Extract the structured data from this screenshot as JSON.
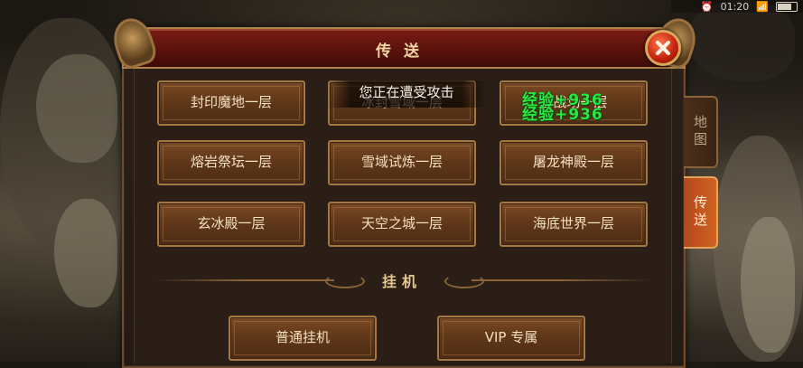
{
  "status": {
    "time": "01:20"
  },
  "panel": {
    "title": "传送"
  },
  "side_tabs": [
    {
      "label": "地图",
      "active": false
    },
    {
      "label": "传送",
      "active": true
    }
  ],
  "teleport": {
    "rows": [
      [
        "封印魔地一层",
        "冰封雪域一层",
        "古战场一层"
      ],
      [
        "熔岩祭坛一层",
        "雪域试炼一层",
        "屠龙神殿一层"
      ],
      [
        "玄冰殿一层",
        "天空之城一层",
        "海底世界一层"
      ]
    ]
  },
  "afk": {
    "section_label": "挂机",
    "buttons": [
      "普通挂机",
      "VIP 专属"
    ]
  },
  "toast": "您正在遭受攻击",
  "exp_messages": [
    "经验+936",
    "经验+936"
  ],
  "colors": {
    "accent": "#d06423",
    "exp_text": "#29e83e",
    "title_bar": "#7a1c14"
  },
  "icons": {
    "close": "close-x-icon",
    "battery": "battery-icon",
    "wifi": "wifi-icon",
    "alarm": "alarm-icon"
  }
}
